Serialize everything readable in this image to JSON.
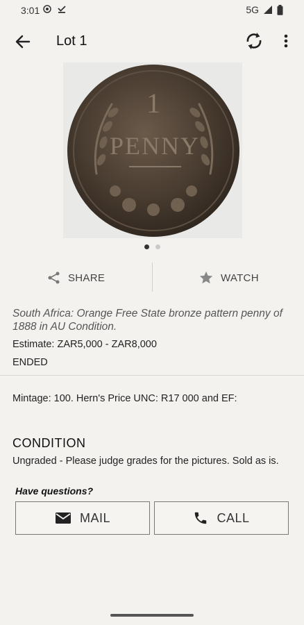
{
  "status_bar": {
    "time": "3:01",
    "network": "5G"
  },
  "app_bar": {
    "title": "Lot 1"
  },
  "icons": {
    "back": "arrow-back-icon",
    "refresh": "refresh-icon",
    "more": "more-vert-icon",
    "share": "share-icon",
    "watch": "star-icon",
    "mail": "mail-icon",
    "call": "phone-icon"
  },
  "image": {
    "coin_text_top": "1",
    "coin_text_main": "PENNY",
    "pager_total": 2,
    "pager_active": 1
  },
  "actions": {
    "share_label": "SHARE",
    "watch_label": "WATCH"
  },
  "lot": {
    "description": "South Africa: Orange Free State bronze pattern penny of 1888 in AU Condition.",
    "estimate": "Estimate: ZAR5,000 - ZAR8,000",
    "status": "ENDED",
    "details": "Mintage: 100. Hern's Price UNC: R17 000 and EF:"
  },
  "condition": {
    "title": "CONDITION",
    "text": "Ungraded - Please judge grades for the pictures. Sold as is."
  },
  "contact": {
    "prompt": "Have questions?",
    "mail_label": "MAIL",
    "call_label": "CALL"
  }
}
